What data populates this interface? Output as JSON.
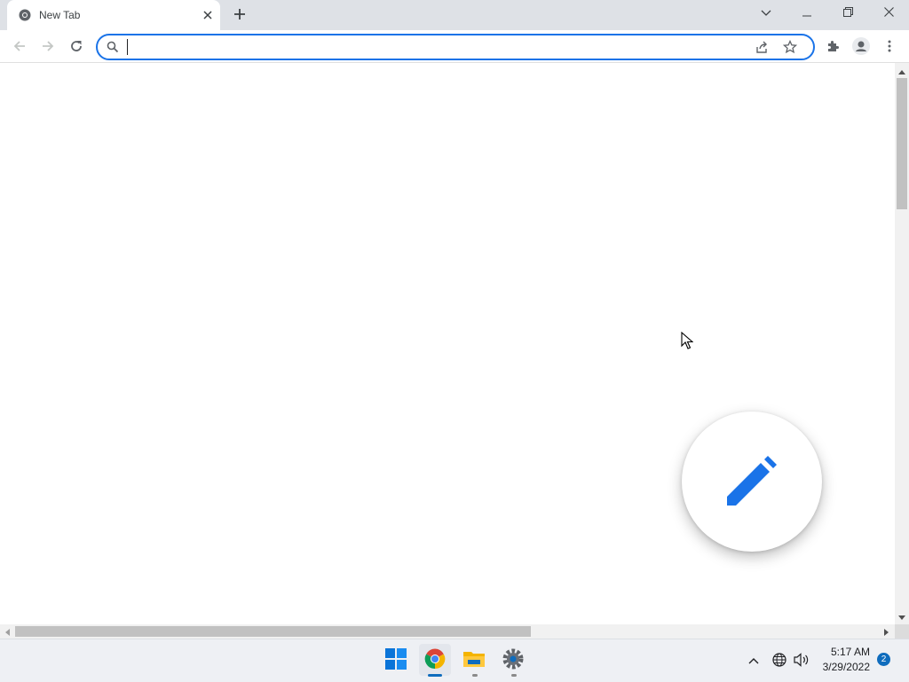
{
  "browser": {
    "tab": {
      "title": "New Tab",
      "close_icon": "close-icon",
      "favicon": "chrome-icon"
    },
    "new_tab_icon": "plus-icon",
    "window_controls": [
      "chevron-down-icon",
      "minimize-icon",
      "restore-icon",
      "close-icon"
    ],
    "nav": [
      "back-arrow-icon",
      "forward-arrow-icon",
      "reload-icon"
    ],
    "omnibox": {
      "value": "",
      "placeholder": "",
      "icons": [
        "search-icon",
        "share-icon",
        "star-icon"
      ]
    },
    "toolbar_right": [
      "extensions-icon",
      "profile-icon",
      "more-vert-icon"
    ],
    "accent": "#1a73e8"
  },
  "page": {
    "fab_icon": "pencil-icon",
    "fab_color": "#1a73e8"
  },
  "taskbar": {
    "apps": [
      "windows-start-icon",
      "chrome-icon",
      "file-explorer-icon",
      "settings-icon"
    ],
    "tray": [
      "chevron-up-icon",
      "network-globe-icon",
      "speaker-icon"
    ],
    "time": "5:17 AM",
    "date": "3/29/2022",
    "notification_count": "2"
  }
}
